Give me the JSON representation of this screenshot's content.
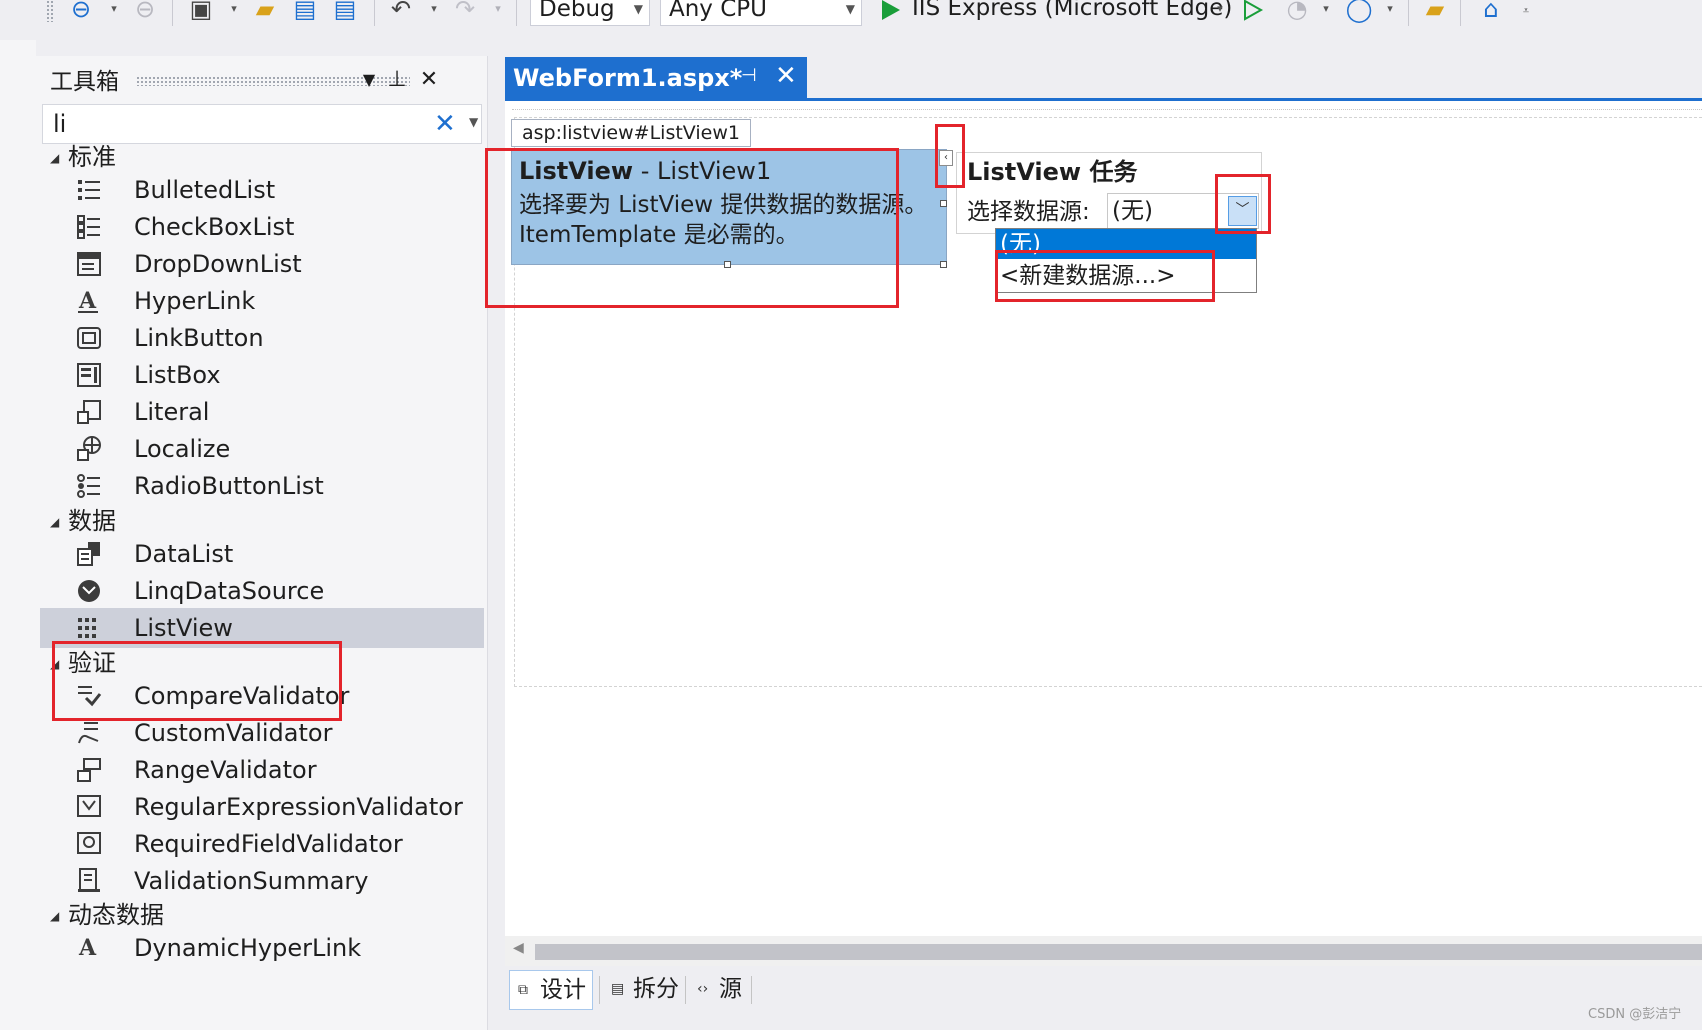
{
  "toolbar": {
    "config_value": "Debug",
    "platform_value": "Any CPU",
    "run_target": "IIS Express (Microsoft Edge)"
  },
  "toolbox": {
    "title": "工具箱",
    "search_value": "li",
    "categories": [
      {
        "name": "标准",
        "items": [
          "BulletedList",
          "CheckBoxList",
          "DropDownList",
          "HyperLink",
          "LinkButton",
          "ListBox",
          "Literal",
          "Localize",
          "RadioButtonList"
        ]
      },
      {
        "name": "数据",
        "items": [
          "DataList",
          "LinqDataSource",
          "ListView"
        ]
      },
      {
        "name": "验证",
        "items": [
          "CompareValidator",
          "CustomValidator",
          "RangeValidator",
          "RegularExpressionValidator",
          "RequiredFieldValidator",
          "ValidationSummary"
        ]
      },
      {
        "name": "动态数据",
        "items": [
          "DynamicHyperLink"
        ]
      }
    ],
    "selected_item": "ListView"
  },
  "document": {
    "tab_title": "WebForm1.aspx*",
    "control_tag": "asp:listview#ListView1",
    "listview": {
      "type_name": "ListView",
      "separator": " - ",
      "instance_name": "ListView1",
      "description_line1": "选择要为 ListView 提供数据的数据源。",
      "description_line2": "ItemTemplate 是必需的。"
    },
    "smart_tag_glyph": "‹",
    "tasks_panel": {
      "title": "ListView 任务",
      "datasource_label": "选择数据源:",
      "datasource_value": "(无)",
      "options": [
        "(无)",
        "<新建数据源...>"
      ]
    }
  },
  "view_tabs": [
    "设计",
    "拆分",
    "源"
  ],
  "watermark": "CSDN @彭洁宁",
  "colors": {
    "accent": "#1e6fcf",
    "highlight_box": "#e3242b",
    "listview_fill": "#9dc4e6",
    "selection": "#0078d7"
  }
}
